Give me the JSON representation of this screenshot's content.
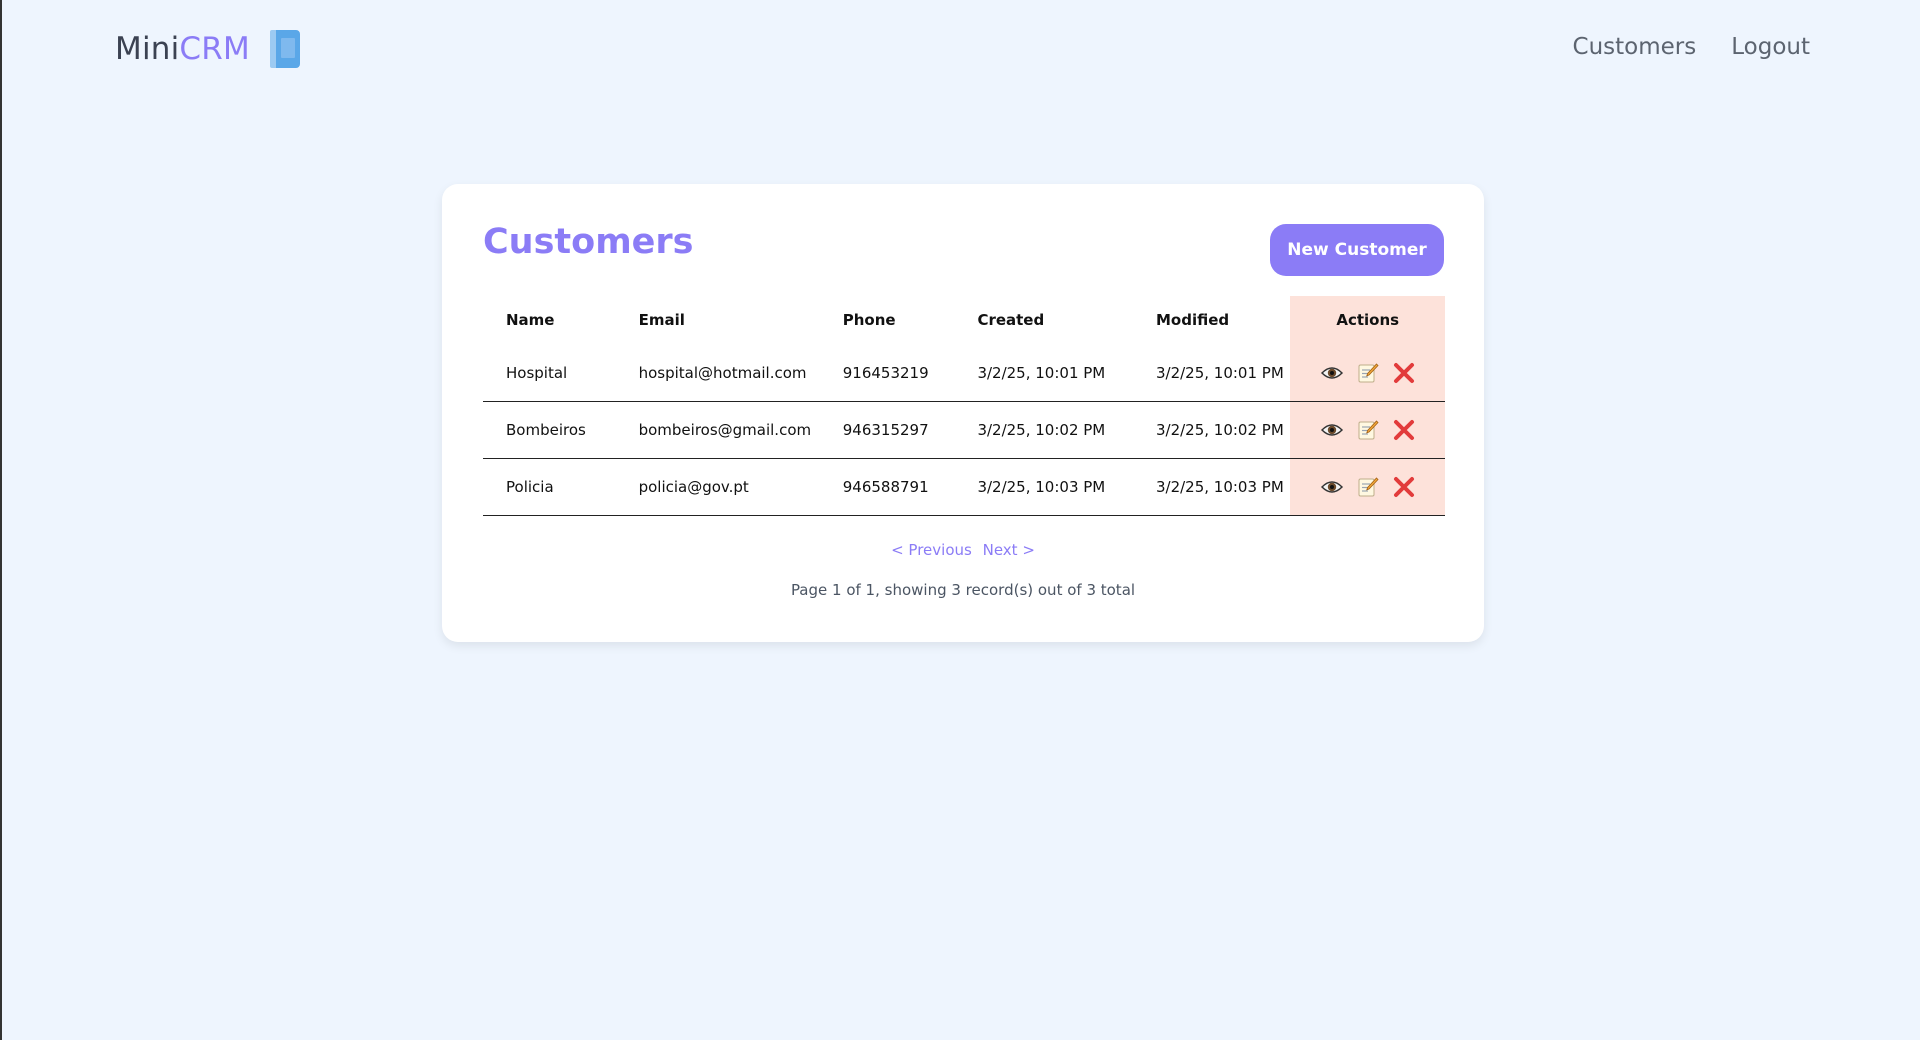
{
  "brand": {
    "part1": "Mini",
    "part2": "CRM",
    "icon": "notebook-icon"
  },
  "nav": {
    "customers": "Customers",
    "logout": "Logout"
  },
  "page": {
    "title": "Customers",
    "new_button": "New Customer"
  },
  "table": {
    "headers": {
      "name": "Name",
      "email": "Email",
      "phone": "Phone",
      "created": "Created",
      "modified": "Modified",
      "actions": "Actions"
    },
    "rows": [
      {
        "name": "Hospital",
        "email": "hospital@hotmail.com",
        "phone": "916453219",
        "created": "3/2/25, 10:01 PM",
        "modified": "3/2/25, 10:01 PM"
      },
      {
        "name": "Bombeiros",
        "email": "bombeiros@gmail.com",
        "phone": "946315297",
        "created": "3/2/25, 10:02 PM",
        "modified": "3/2/25, 10:02 PM"
      },
      {
        "name": "Policia",
        "email": "policia@gov.pt",
        "phone": "946588791",
        "created": "3/2/25, 10:03 PM",
        "modified": "3/2/25, 10:03 PM"
      }
    ],
    "action_icons": [
      "eye-icon",
      "edit-memo-icon",
      "delete-x-icon"
    ]
  },
  "pagination": {
    "previous": "< Previous",
    "next": "Next >",
    "info": "Page 1 of 1, showing 3 record(s) out of 3 total"
  },
  "colors": {
    "accent": "#8b7cf6",
    "background": "#eef5fe",
    "actions_bg": "#fde2da",
    "delete": "#e23b3b"
  }
}
